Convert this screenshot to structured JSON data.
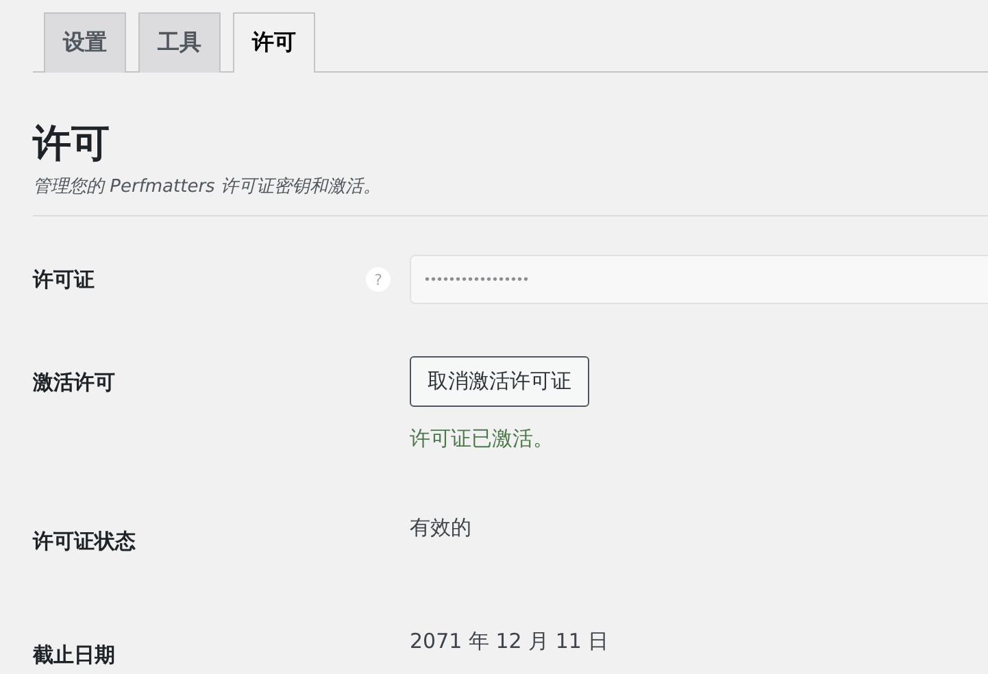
{
  "tabs": [
    {
      "label": "设置",
      "selected": false
    },
    {
      "label": "工具",
      "selected": false
    },
    {
      "label": "许可",
      "selected": true
    }
  ],
  "heading": "许可",
  "description": "管理您的 Perfmatters 许可证密钥和激活。",
  "rows": [
    {
      "kind": "input",
      "label": "许可证",
      "help": "?",
      "value": "•••••••••••••••••"
    },
    {
      "kind": "button",
      "label": "激活许可",
      "button": "取消激活许可证",
      "message": "许可证已激活。"
    },
    {
      "kind": "text",
      "label": "许可证状态",
      "value": "有效的"
    },
    {
      "kind": "text",
      "label": "截止日期",
      "value": "2071 年 12 月 11 日"
    }
  ]
}
